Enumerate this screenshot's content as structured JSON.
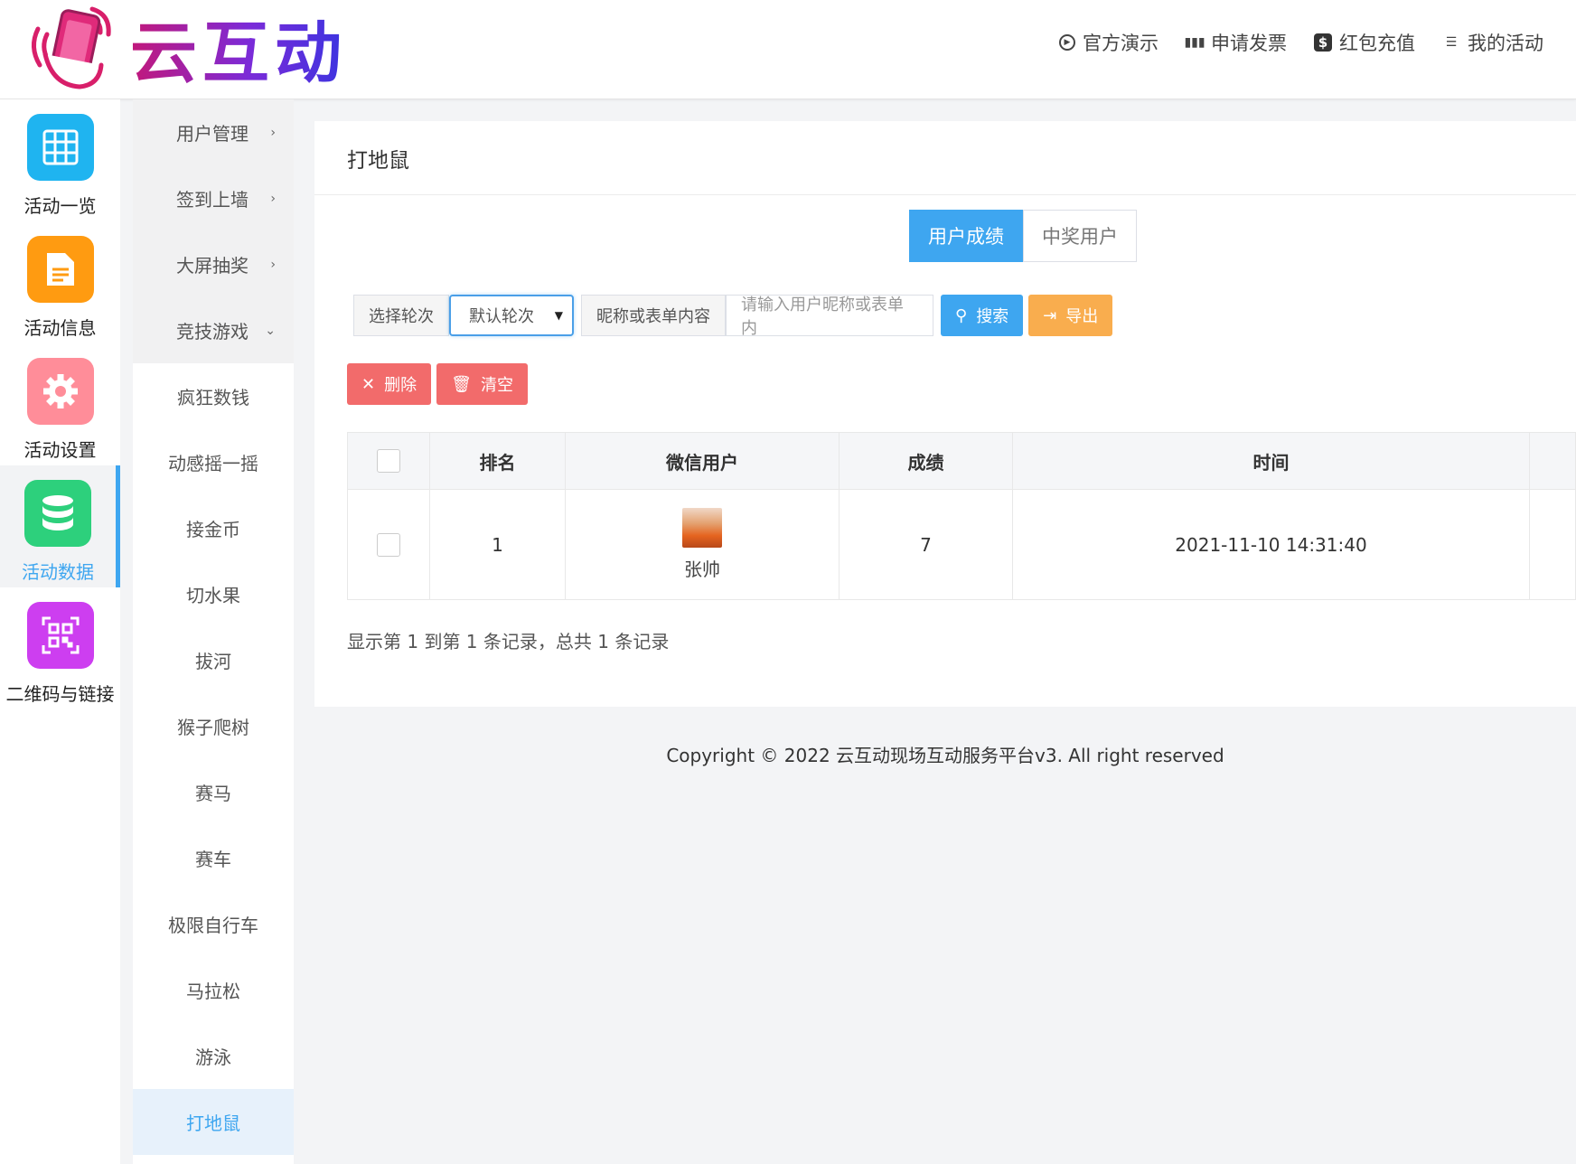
{
  "brand": {
    "name": "云互动"
  },
  "topnav": [
    {
      "label": "官方演示",
      "icon": "play-circle-icon"
    },
    {
      "label": "申请发票",
      "icon": "barcode-icon"
    },
    {
      "label": "红包充值",
      "icon": "dollar-icon"
    },
    {
      "label": "我的活动",
      "icon": "list-icon"
    }
  ],
  "iconbar": [
    {
      "label": "活动一览",
      "icon": "grid-icon",
      "color": "#1fb4f0"
    },
    {
      "label": "活动信息",
      "icon": "document-icon",
      "color": "#ff9b11"
    },
    {
      "label": "活动设置",
      "icon": "gear-icon",
      "color": "#ff8d99"
    },
    {
      "label": "活动数据",
      "icon": "database-icon",
      "color": "#2dd07c"
    },
    {
      "label": "二维码与链接",
      "icon": "qrcode-icon",
      "color": "#cd3ef0"
    }
  ],
  "submenu": {
    "parents": [
      "用户管理",
      "签到上墙",
      "大屏抽奖",
      "竞技游戏"
    ],
    "games": [
      "疯狂数钱",
      "动感摇一摇",
      "接金币",
      "切水果",
      "拔河",
      "猴子爬树",
      "赛马",
      "赛车",
      "极限自行车",
      "马拉松",
      "游泳",
      "打地鼠"
    ]
  },
  "page": {
    "title": "打地鼠",
    "tabs": [
      "用户成绩",
      "中奖用户"
    ]
  },
  "filters": {
    "round_label": "选择轮次",
    "round_value": "默认轮次",
    "keyword_label": "昵称或表单内容",
    "keyword_placeholder": "请输入用户昵称或表单内",
    "search": "搜索",
    "export": "导出"
  },
  "actions": {
    "delete": "删除",
    "clear": "清空"
  },
  "table": {
    "columns": [
      "排名",
      "微信用户",
      "成绩",
      "时间"
    ],
    "rows": [
      {
        "rank": "1",
        "user": "张帅",
        "score": "7",
        "time": "2021-11-10 14:31:40"
      }
    ]
  },
  "pagination": {
    "info": "显示第 1 到第 1 条记录，总共 1 条记录"
  },
  "footer": {
    "copyright": "Copyright © 2022 云互动现场互动服务平台v3. All right reserved"
  },
  "colors": {
    "accent": "#3ea6f0",
    "danger": "#f26b6b",
    "warning": "#f9ad4e"
  }
}
